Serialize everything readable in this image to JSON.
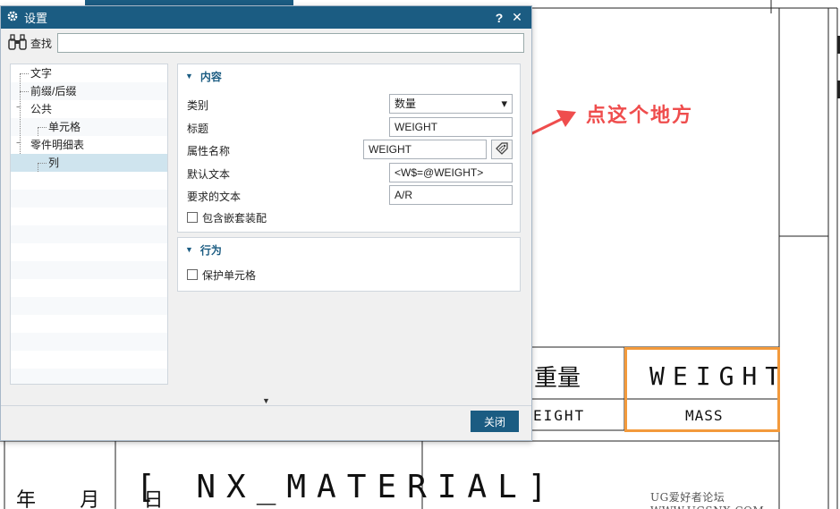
{
  "dialog": {
    "title": "设置",
    "help_label": "?",
    "close_label": "✕",
    "search_label": "查找",
    "search_value": "",
    "close_button": "关闭",
    "expand_icon": "caret-down-icon"
  },
  "tree": {
    "items": [
      {
        "label": "文字",
        "level": 1
      },
      {
        "label": "前缀/后缀",
        "level": 1
      },
      {
        "label": "公共",
        "level": 1,
        "expanded": true
      },
      {
        "label": "单元格",
        "level": 2
      },
      {
        "label": "零件明细表",
        "level": 1,
        "expanded": true
      },
      {
        "label": "列",
        "level": 2,
        "selected": true
      }
    ],
    "expand_symbol": "−"
  },
  "content_group": {
    "header": "内容",
    "category_label": "类别",
    "category_value": "数量",
    "heading_label": "标题",
    "heading_value": "WEIGHT",
    "attribute_label": "属性名称",
    "attribute_value": "WEIGHT",
    "default_text_label": "默认文本",
    "default_text_value": "<W$=@WEIGHT>",
    "required_text_label": "要求的文本",
    "required_text_value": "A/R",
    "include_nested_label": "包含嵌套装配",
    "include_nested_checked": false
  },
  "behavior_group": {
    "header": "行为",
    "protect_cell_label": "保护单元格",
    "protect_cell_checked": false
  },
  "annotation": {
    "text": "点这个地方",
    "color": "#ef4d4d"
  },
  "drawing": {
    "weight_title": "WEIGHT",
    "mass": "MASS",
    "zhongliang": "重量",
    "eight": "EIGHT",
    "material": "[ NX_MATERIAL]",
    "date": "年 月 日",
    "watermark": "UG爱好者论坛 WWW.UGSNX.COM"
  },
  "colors": {
    "titlebar": "#1b5c82",
    "highlight": "#f39a3c",
    "selected_row": "#cfe4ee"
  }
}
